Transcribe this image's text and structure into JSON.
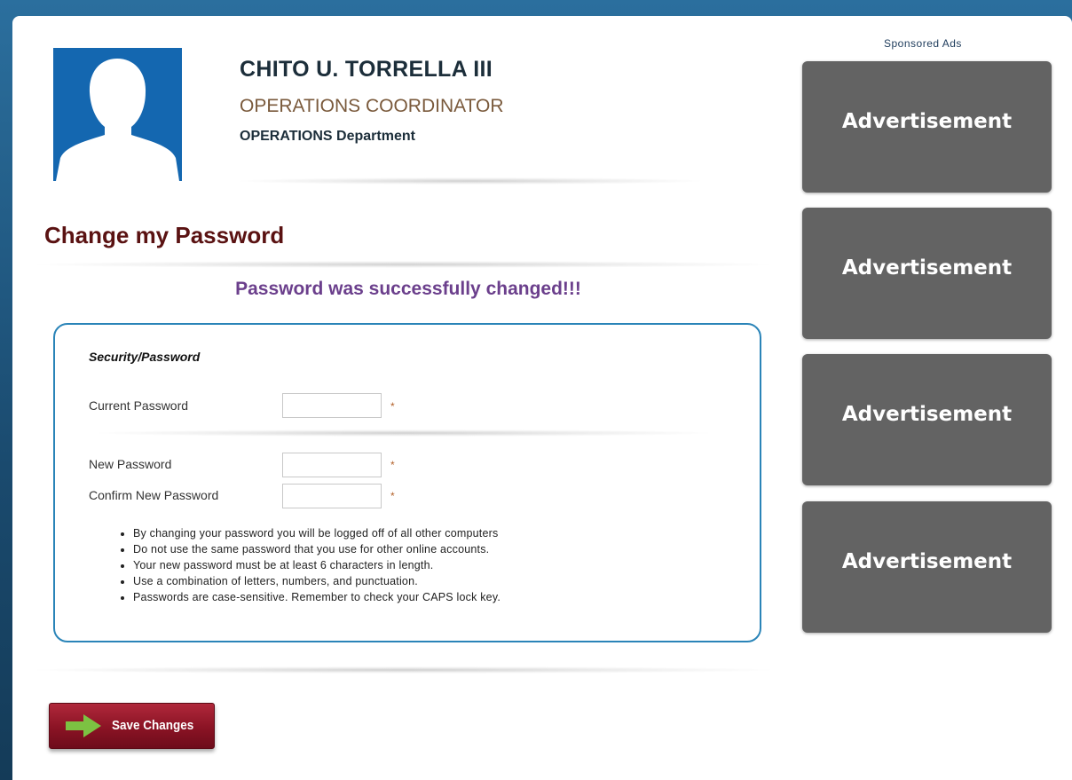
{
  "profile": {
    "name": "CHITO U. TORRELLA III",
    "position": "OPERATIONS COORDINATOR",
    "department": "OPERATIONS Department"
  },
  "page": {
    "title": "Change my Password",
    "success_message": "Password was successfully changed!!!"
  },
  "form": {
    "section_label": "Security/Password",
    "fields": [
      {
        "label": "Current Password",
        "value": "",
        "required_mark": "*"
      },
      {
        "label": "New Password",
        "value": "",
        "required_mark": "*"
      },
      {
        "label": "Confirm New Password",
        "value": "",
        "required_mark": "*"
      }
    ],
    "rules": [
      "By changing your password you will be logged off of all other computers",
      "Do not use the same password that you use for other online accounts.",
      "Your new password must be at least 6 characters in length.",
      "Use a combination of letters, numbers, and punctuation.",
      "Passwords are case-sensitive. Remember to check your CAPS lock key."
    ],
    "save_label": "Save Changes"
  },
  "ads": {
    "label": "Sponsored Ads",
    "items": [
      "Advertisement",
      "Advertisement",
      "Advertisement",
      "Advertisement"
    ]
  },
  "colors": {
    "page_bg": "#2b6f9e",
    "avatar_bg": "#1467b0",
    "title_color": "#5a1212",
    "success_color": "#6b3f8c",
    "box_border": "#2a84b8",
    "button": "#8a1324",
    "ad_bg": "#636363"
  },
  "icons": [
    "user-silhouette-icon",
    "green-arrow-icon"
  ]
}
